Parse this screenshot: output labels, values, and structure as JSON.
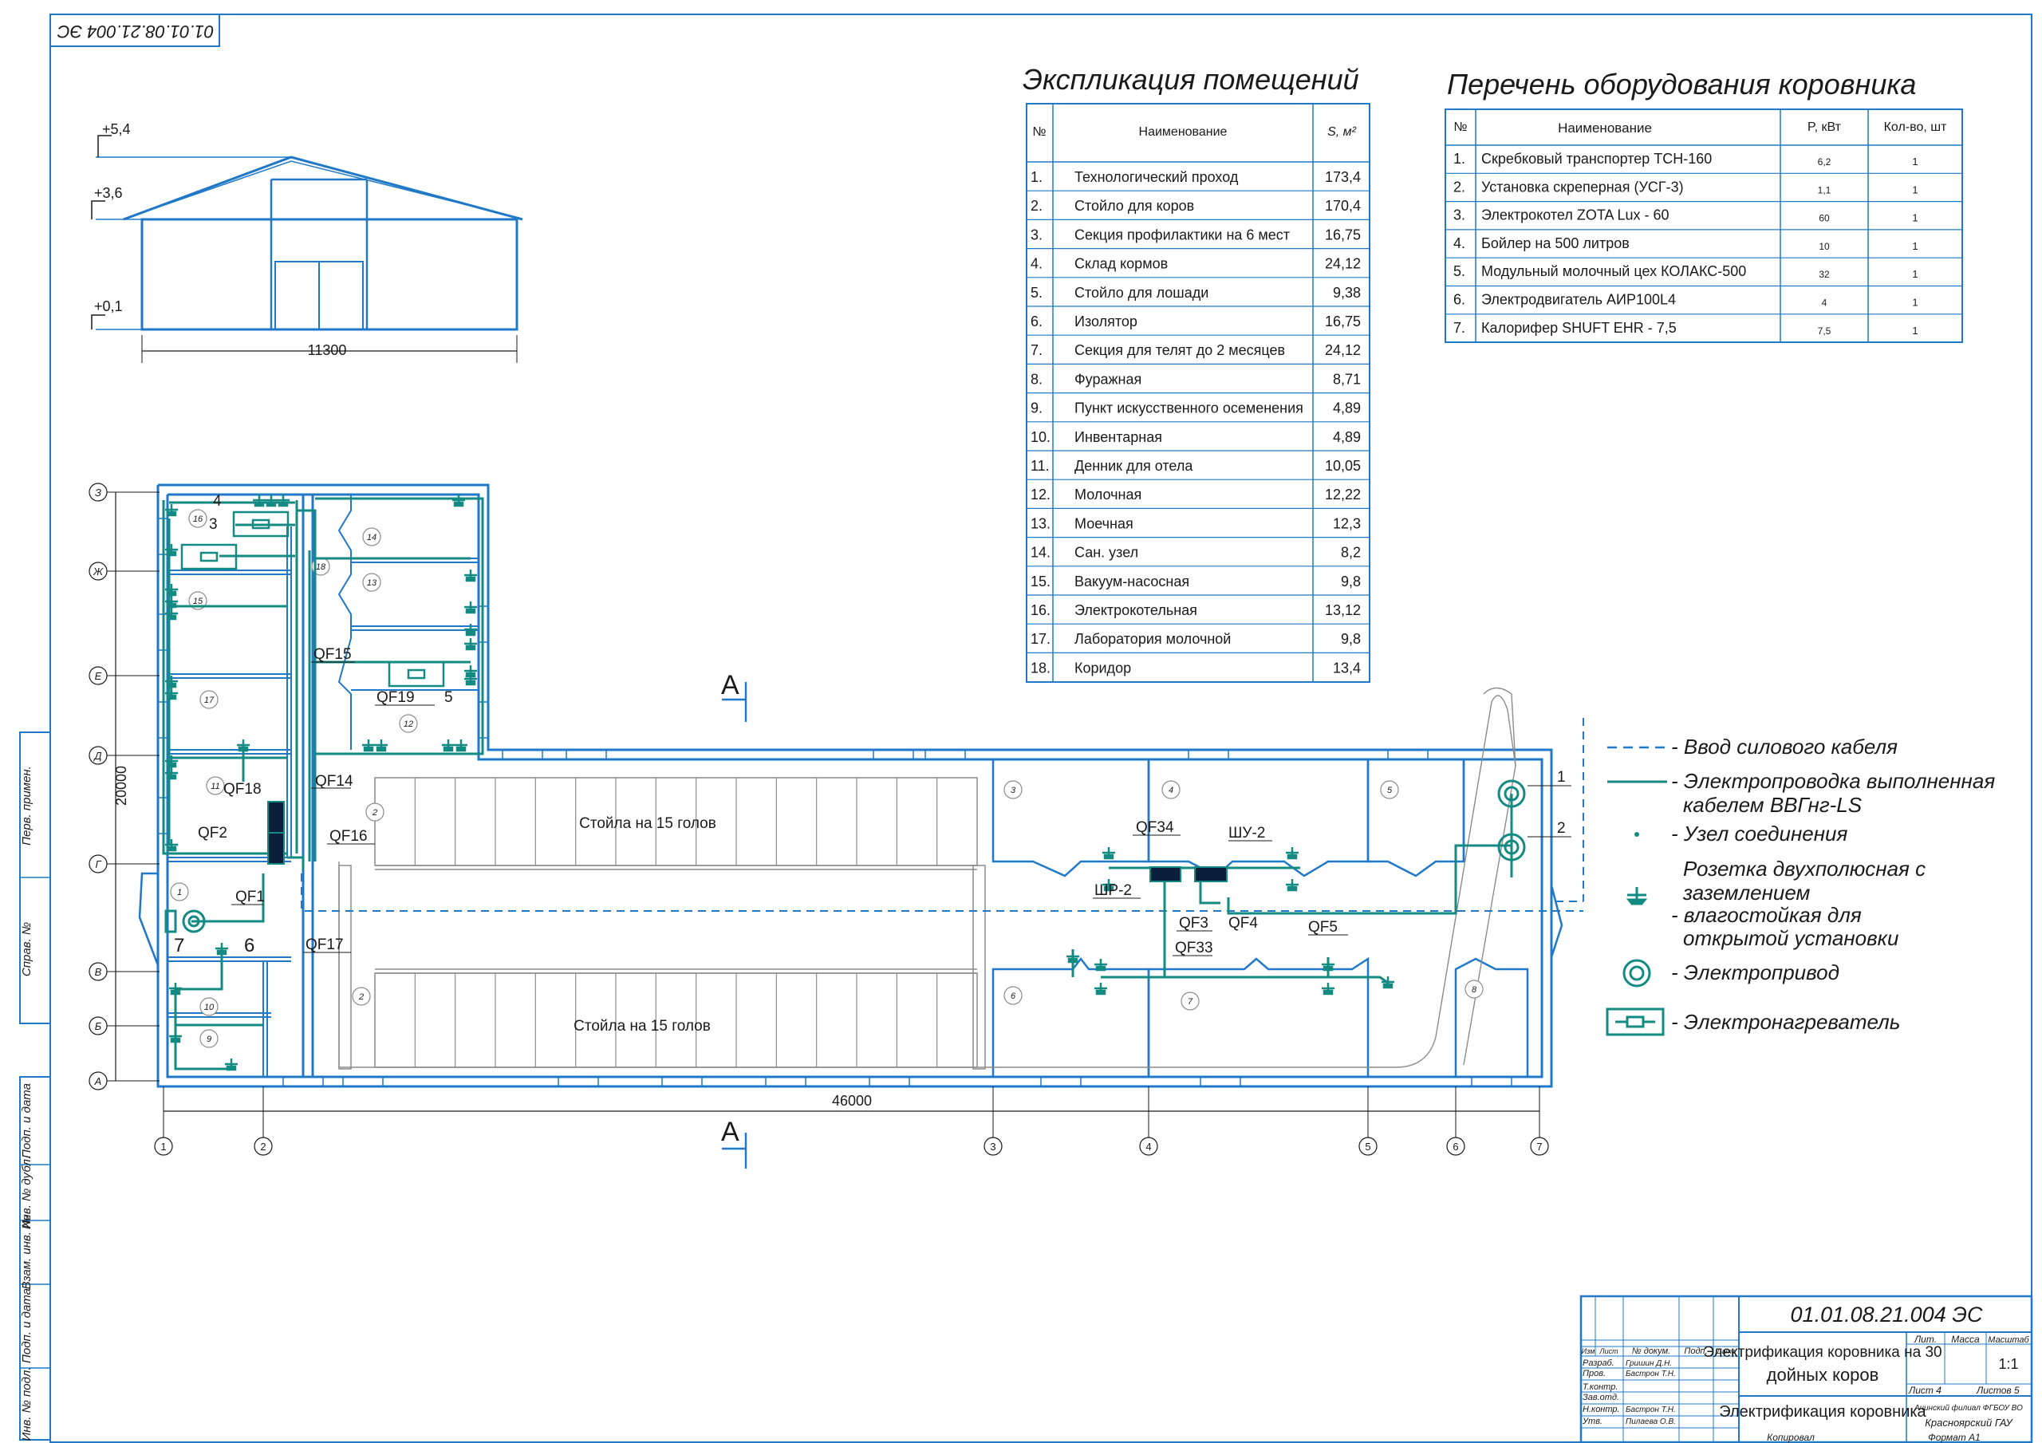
{
  "stamp_code_rotated": "01.01.08.21.004 ЭС",
  "elevation": {
    "levels": [
      "+5,4",
      "+3,6",
      "+0,1"
    ],
    "width_dim": "11300"
  },
  "explication": {
    "title": "Экспликация помещений",
    "headers": [
      "№",
      "Наименование",
      "S, м²"
    ],
    "rows": [
      [
        "1.",
        "Технологический  проход",
        "173,4"
      ],
      [
        "2.",
        "Стойло  для коров",
        "170,4"
      ],
      [
        "3.",
        "Секция профилактики  на  6 мест",
        "16,75"
      ],
      [
        "4.",
        "Склад  кормов",
        "24,12"
      ],
      [
        "5.",
        "Стойло  для  лошади",
        "9,38"
      ],
      [
        "6.",
        "Изолятор",
        "16,75"
      ],
      [
        "7.",
        "Секция  для  телят до 2 месяцев",
        "24,12"
      ],
      [
        "8.",
        "Фуражная",
        "8,71"
      ],
      [
        "9.",
        "Пункт искусственного осеменения",
        "4,89"
      ],
      [
        "10.",
        "Инвентарная",
        "4,89"
      ],
      [
        "11.",
        "Денник  для  отела",
        "10,05"
      ],
      [
        "12.",
        "Молочная",
        "12,22"
      ],
      [
        "13.",
        "Моечная",
        "12,3"
      ],
      [
        "14.",
        "Сан. узел",
        "8,2"
      ],
      [
        "15.",
        "Вакуум-насосная",
        "9,8"
      ],
      [
        "16.",
        "Электрокотельная",
        "13,12"
      ],
      [
        "17.",
        "Лаборатория молочной",
        "9,8"
      ],
      [
        "18.",
        "Коридор",
        "13,4"
      ]
    ]
  },
  "equipment": {
    "title": "Перечень  оборудования коровника",
    "headers": [
      "№",
      "Наименование",
      "P, кВт",
      "Кол-во, шт"
    ],
    "rows": [
      [
        "1.",
        "Скребковый транспортер ТСН-160",
        "6,2",
        "1"
      ],
      [
        "2.",
        "Установка скреперная (УСГ-3)",
        "1,1",
        "1"
      ],
      [
        "3.",
        "Электрокотел  ZOTA Lux - 60",
        "60",
        "1"
      ],
      [
        "4.",
        "Бойлер  на 500 литров",
        "10",
        "1"
      ],
      [
        "5.",
        "Модульный молочный цех  КОЛАКС-500",
        "32",
        "1"
      ],
      [
        "6.",
        "Электродвигатель АИР100L4",
        "4",
        "1"
      ],
      [
        "7.",
        "Калорифер SHUFT EHR - 7,5",
        "7,5",
        "1"
      ]
    ]
  },
  "legend": [
    {
      "icon": "dashed-line-icon",
      "label": "- Ввод силового кабеля"
    },
    {
      "icon": "solid-line-icon",
      "label": "- Электропроводка выполненная",
      "label2": "кабелем ВВГнг-LS"
    },
    {
      "icon": "dot-icon",
      "label": "- Узел соединения"
    },
    {
      "icon": "socket-icon",
      "label": "Розетка двухполюсная с",
      "label2": "заземлением",
      "label3": "- влагостойкая для",
      "label4": "открытой установки"
    },
    {
      "icon": "motor-icon",
      "label": "- Электропривод"
    },
    {
      "icon": "heater-icon",
      "label": "- Электронагреватель"
    }
  ],
  "plan": {
    "axes_letters": [
      "З",
      "Ж",
      "Е",
      "Д",
      "Г",
      "В",
      "Б",
      "А"
    ],
    "axes_numbers": [
      "1",
      "2",
      "3",
      "4",
      "5",
      "6",
      "7"
    ],
    "dim_height": "20000",
    "dim_length": "46000",
    "stall_label": "Стойла на 15 голов",
    "section_mark": "A",
    "room_numbers": [
      "1",
      "2",
      "3",
      "4",
      "5",
      "6",
      "7",
      "8",
      "9",
      "10",
      "11",
      "12",
      "13",
      "14",
      "15",
      "16",
      "17",
      "18"
    ],
    "breakers": [
      "QF15",
      "QF19",
      "QF14",
      "QF18",
      "QF2",
      "QF16",
      "QF1",
      "QF17",
      "QF34",
      "ШУ-2",
      "ШР-2",
      "QF3",
      "QF4",
      "QF5",
      "QF33"
    ],
    "equip_markers": [
      "1",
      "2",
      "3",
      "4",
      "5",
      "6",
      "7"
    ]
  },
  "title_block": {
    "code": "01.01.08.21.004 ЭС",
    "project_title_1": "Электрификация коровника на 30",
    "project_title_2": "дойных коров",
    "sheet_title": "Электрификация коровника",
    "col_headers": [
      "Изм",
      "Лист",
      "№ докум.",
      "Подп.",
      "Дата"
    ],
    "roles": [
      "Разраб.",
      "Пров.",
      "Т.контр.",
      "Зав.отд.",
      "Н.контр.",
      "Утв."
    ],
    "names": [
      "Гришин Д.Н.",
      "Бастрон Т.Н.",
      "",
      "",
      "Бастрон Т.Н.",
      "Пилаева О.В."
    ],
    "lit_header": "Лит.",
    "mass_header": "Масса",
    "scale_header": "Масштаб",
    "scale": "1:1",
    "sheet": "Лист   4",
    "sheets": "Листов    5",
    "org_1": "Ачинский филиал ФГБОУ ВО",
    "org_2": "Красноярский ГАУ",
    "copied": "Копировал",
    "format": "Формат  А1"
  },
  "side_strip": [
    "Перв. примен.",
    "Справ. №",
    "Подп. и дата",
    "Инв. № дубл.",
    "Взам. инв. №",
    "Подп. и дата",
    "Инв. № подл."
  ]
}
